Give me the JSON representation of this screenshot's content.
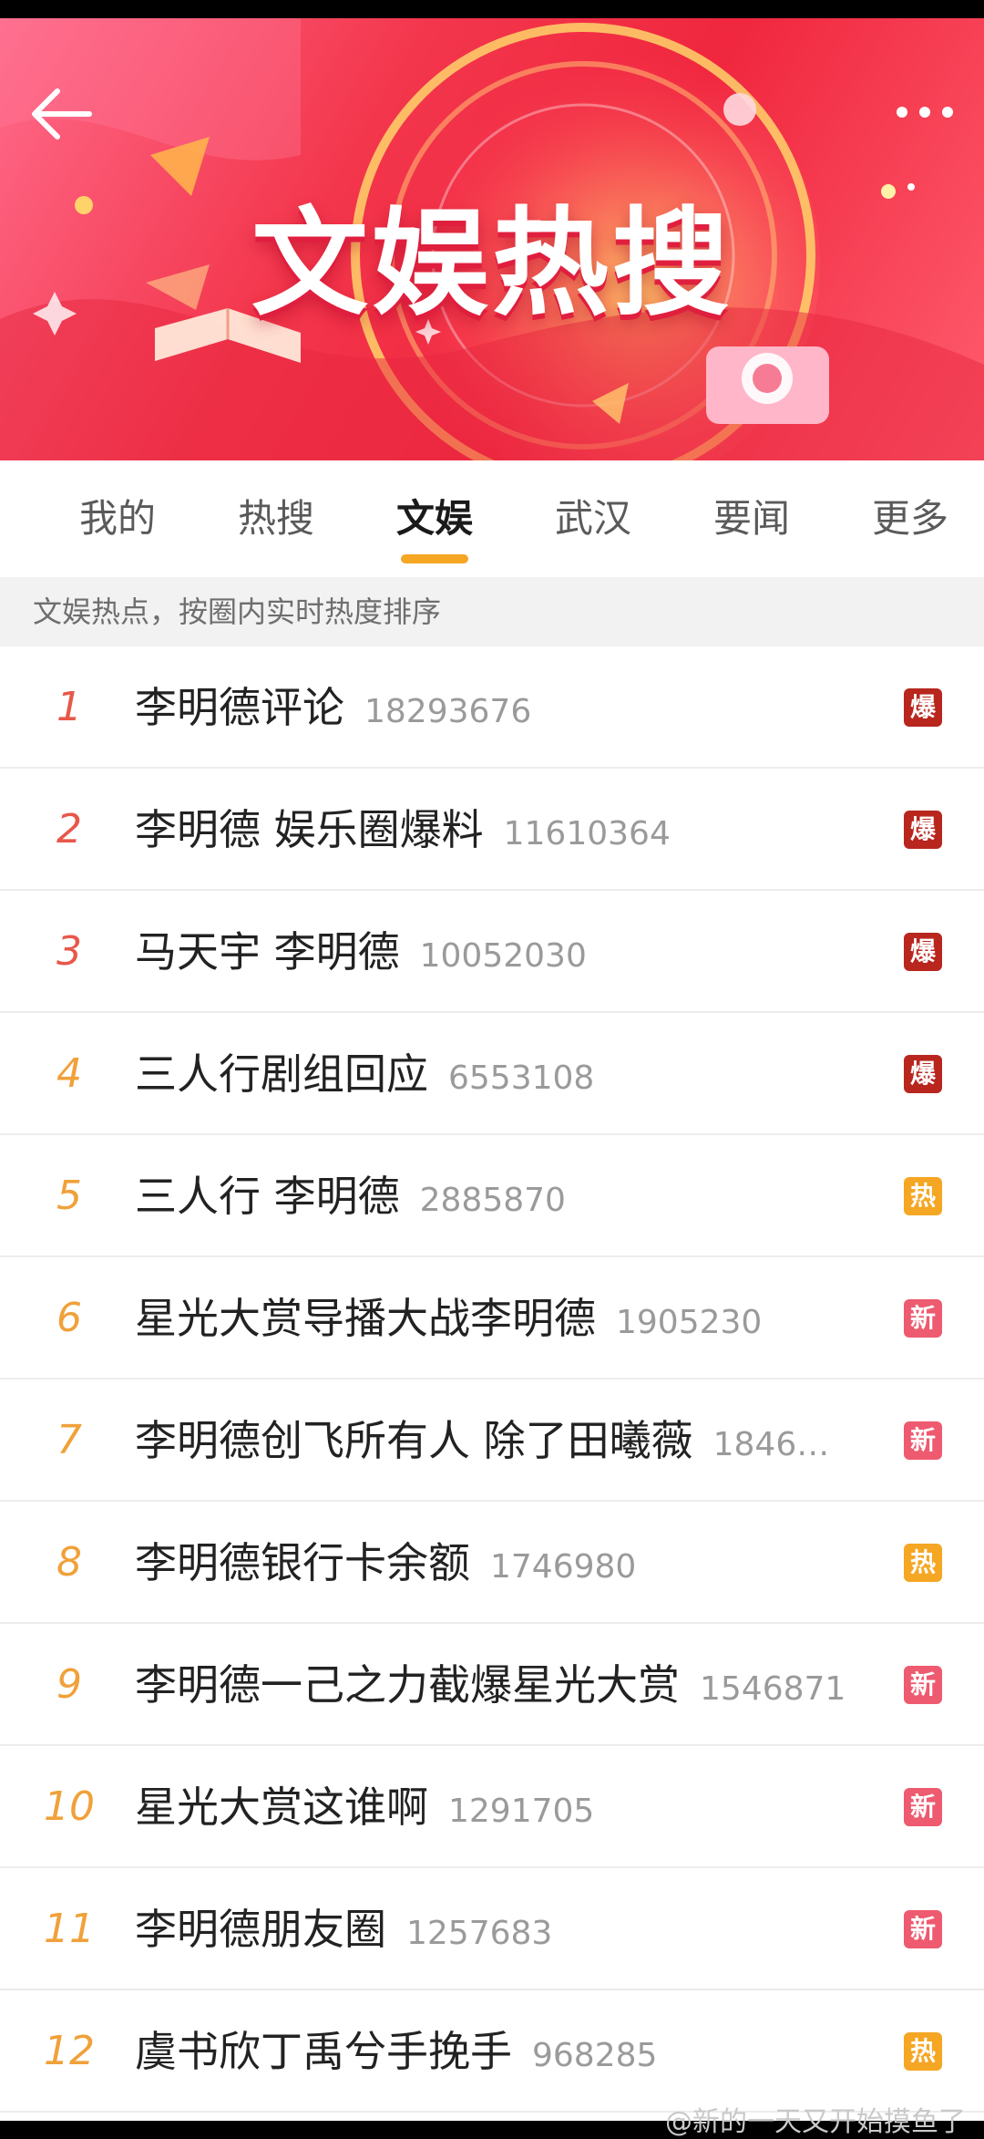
{
  "banner": {
    "title": "文娱热搜"
  },
  "tabs": [
    {
      "label": "我的"
    },
    {
      "label": "热搜"
    },
    {
      "label": "文娱"
    },
    {
      "label": "武汉"
    },
    {
      "label": "要闻"
    },
    {
      "label": "更多"
    }
  ],
  "active_tab": "文娱",
  "subheader": "文娱热点，按圈内实时热度排序",
  "items": [
    {
      "rank": "1",
      "title": "李明德评论",
      "count": "18293676",
      "badge": "爆"
    },
    {
      "rank": "2",
      "title": "李明德 娱乐圈爆料",
      "count": "11610364",
      "badge": "爆"
    },
    {
      "rank": "3",
      "title": "马天宇 李明德",
      "count": "10052030",
      "badge": "爆"
    },
    {
      "rank": "4",
      "title": "三人行剧组回应",
      "count": "6553108",
      "badge": "爆"
    },
    {
      "rank": "5",
      "title": "三人行 李明德",
      "count": "2885870",
      "badge": "热"
    },
    {
      "rank": "6",
      "title": "星光大赏导播大战李明德",
      "count": "1905230",
      "badge": "新"
    },
    {
      "rank": "7",
      "title": "李明德创飞所有人 除了田曦薇",
      "count": "1846…",
      "badge": "新"
    },
    {
      "rank": "8",
      "title": "李明德银行卡余额",
      "count": "1746980",
      "badge": "热"
    },
    {
      "rank": "9",
      "title": "李明德一己之力截爆星光大赏",
      "count": "1546871",
      "badge": "新"
    },
    {
      "rank": "10",
      "title": "星光大赏这谁啊",
      "count": "1291705",
      "badge": "新"
    },
    {
      "rank": "11",
      "title": "李明德朋友圈",
      "count": "1257683",
      "badge": "新"
    },
    {
      "rank": "12",
      "title": "虞书欣丁禹兮手挽手",
      "count": "968285",
      "badge": "热"
    }
  ],
  "badge_colors": {
    "爆": "#b8261e",
    "热": "#f5a623",
    "新": "#ee5a6f"
  },
  "icons": {
    "back": "back-arrow-icon",
    "more": "more-dots-icon"
  },
  "watermark": "@新的一天又开始摸鱼了"
}
